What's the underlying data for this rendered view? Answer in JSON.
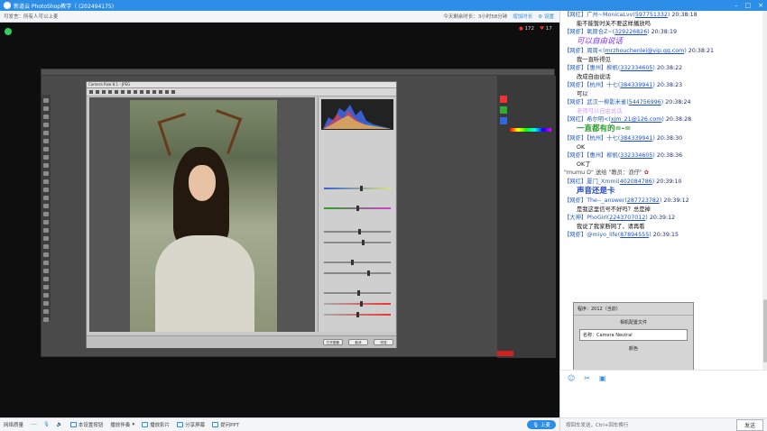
{
  "window": {
    "title": "新道云 PhotoShop教学（ (202494175)",
    "controls": [
      "–",
      "□",
      "×"
    ]
  },
  "topbar": {
    "left": "可发言：所有人可以上麦",
    "duration_label": "今天剩余时长：3小时58分钟",
    "link1": "增加时长",
    "link2": "设置",
    "viewers": "172",
    "likes": "17"
  },
  "bottombar": {
    "network_label": "网络质量",
    "network_value": "------",
    "items": [
      "本设置按钮",
      "播放伴奏",
      "播放影片",
      "分享屏幕",
      "提问PPT"
    ],
    "up_label": "上麦"
  },
  "chat": {
    "messages": [
      {
        "meta": "【网红】广州~MonicaLvv",
        "link": "597751332",
        "time": "20:38:18",
        "text": "能不能暂时关不要这样播放吗",
        "style": "txt"
      },
      {
        "meta": "【网虾】氧原合Z~",
        "link": "329226826",
        "time": "20:38:19",
        "text": "可以自由说话",
        "style": "purple"
      },
      {
        "meta": "【网虾】周周<",
        "link": "mrzhouchenlei@vip.qq.com",
        "time": "20:38:21",
        "text": "我一直听得见",
        "style": "txt"
      },
      {
        "meta": "【网虾】【惠州】柳帆",
        "link": "332334605",
        "time": "20:38:22",
        "text": "改成自由说话",
        "style": "txt"
      },
      {
        "meta": "【网虾】【杭州】十七",
        "link": "384339941",
        "time": "20:38:23",
        "text": "可以",
        "style": "txt"
      },
      {
        "meta": "【网虾】武汉一柳影米雀",
        "link": "544756996",
        "time": "20:38:24",
        "text": "老师可以自由说话",
        "style": "faint"
      },
      {
        "meta": "【网红】希尔明<",
        "link": "xjm_21@126.com",
        "time": "20:38:28",
        "text": "一直都有的=-=",
        "style": "green"
      },
      {
        "meta": "【网虾】【杭州】十七",
        "link": "384339941",
        "time": "20:38:30",
        "text": "OK",
        "style": "txt"
      },
      {
        "meta": "【网虾】【惠州】柳帆",
        "link": "332334605",
        "time": "20:38:36",
        "text": "OK了",
        "style": "txt"
      }
    ],
    "system_line": "\"mumu D\" 送给 \"教员：浪仔\"",
    "messages2": [
      {
        "meta": "【网红】厦门_Xmmi",
        "link": "402084786",
        "time": "20:39:10",
        "text": "声音还是卡",
        "style": "bluebig"
      },
      {
        "meta": "【网虾】The--_answer",
        "link": "287723782",
        "time": "20:39:12",
        "text": "是我这里信号不好吗？总是掉",
        "style": "txt"
      },
      {
        "meta": "【大神】PhoGirl",
        "link": "2243707012",
        "time": "20:39:12",
        "text": "我说了我家断网了，请再看",
        "style": "txt"
      },
      {
        "meta": "【网虾】@miyo_life",
        "link": "87894555",
        "time": "20:39:15",
        "text": "",
        "style": "txt"
      }
    ],
    "shot": {
      "row1": "程序：2012（当前）",
      "row2": "相机配置文件",
      "row3": "名称：Camera Neutral",
      "row4": "颜色"
    },
    "footer_hint": "按回车发送，Ctrl+回车换行",
    "send_label": "发送"
  },
  "cr_dialog": {
    "title": "Camera Raw 8.1 - JPEG",
    "open_btn": "打开图像",
    "cancel_btn": "取消",
    "done_btn": "完成"
  },
  "colors": {
    "accent": "#2c8ee6",
    "live": "#2ed15a"
  }
}
